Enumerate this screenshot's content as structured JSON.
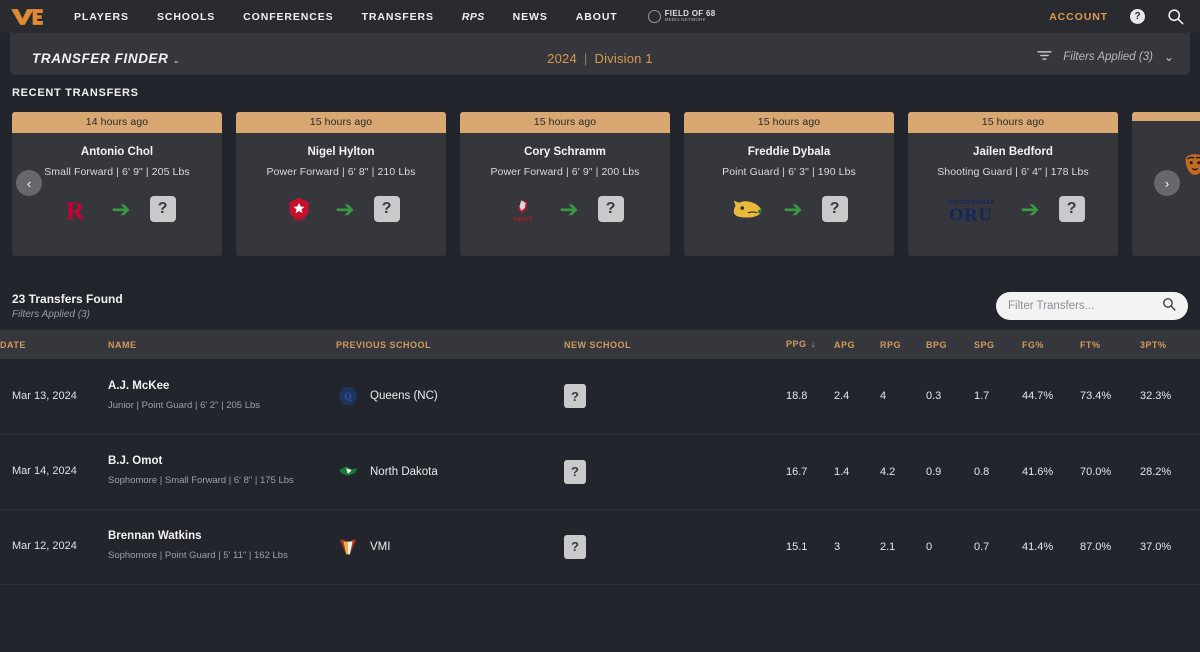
{
  "nav": {
    "logo_name": "verbal-commits-logo",
    "links": [
      {
        "label": "PLAYERS",
        "active": false
      },
      {
        "label": "SCHOOLS",
        "active": false
      },
      {
        "label": "CONFERENCES",
        "active": false
      },
      {
        "label": "TRANSFERS",
        "active": false
      },
      {
        "label": "RPS",
        "active": true
      },
      {
        "label": "NEWS",
        "active": false
      },
      {
        "label": "ABOUT",
        "active": false
      }
    ],
    "partner": {
      "line1": "FIELD OF 68",
      "line2": "MEDIA NETWORK"
    },
    "account_label": "ACCOUNT",
    "help_glyph": "?",
    "accent": "#d89a4e"
  },
  "finder": {
    "title": "TRANSFER FINDER",
    "caret": "⌄",
    "season": "2024",
    "separator": "|",
    "division": "Division 1",
    "filters_label": "Filters Applied (3)",
    "chevron": "⌄"
  },
  "recent": {
    "heading": "RECENT TRANSFERS",
    "prev_glyph": "‹",
    "next_glyph": "›",
    "arrow_glyph": "➔",
    "unknown_glyph": "?",
    "cards": [
      {
        "time": "14 hours ago",
        "name": "Antonio Chol",
        "meta": "Small Forward  |  6' 9\"  |  205 Lbs",
        "from_logo": "rutgers-logo"
      },
      {
        "time": "15 hours ago",
        "name": "Nigel Hylton",
        "meta": "Power Forward  |  6' 8\"  |  210 Lbs",
        "from_logo": "sfu-logo"
      },
      {
        "time": "15 hours ago",
        "name": "Cory Schramm",
        "meta": "Power Forward  |  6' 9\"  |  200 Lbs",
        "from_logo": "saints-logo"
      },
      {
        "time": "15 hours ago",
        "name": "Freddie Dybala",
        "meta": "Point Guard  |  6' 3\"  |  190 Lbs",
        "from_logo": "golden-cat-logo"
      },
      {
        "time": "15 hours ago",
        "name": "Jailen Bedford",
        "meta": "Shooting Guard  |  6' 4\"  |  178 Lbs",
        "from_logo": "oru-logo"
      },
      {
        "time": "",
        "name": "",
        "meta": "",
        "from_logo": "tiger-logo"
      }
    ]
  },
  "results": {
    "count_label": "23 Transfers Found",
    "filters_label": "Filters Applied (3)",
    "filter_placeholder": "Filter Transfers...",
    "filter_value": ""
  },
  "table": {
    "columns": [
      {
        "key": "date",
        "label": "DATE",
        "sorted": false
      },
      {
        "key": "name",
        "label": "NAME",
        "sorted": false
      },
      {
        "key": "prev",
        "label": "PREVIOUS SCHOOL",
        "sorted": false
      },
      {
        "key": "new",
        "label": "NEW SCHOOL",
        "sorted": false
      },
      {
        "key": "ppg",
        "label": "PPG",
        "sorted": true,
        "sort_dir": "↓"
      },
      {
        "key": "apg",
        "label": "APG",
        "sorted": false
      },
      {
        "key": "rpg",
        "label": "RPG",
        "sorted": false
      },
      {
        "key": "bpg",
        "label": "BPG",
        "sorted": false
      },
      {
        "key": "spg",
        "label": "SPG",
        "sorted": false
      },
      {
        "key": "fg",
        "label": "FG%",
        "sorted": false
      },
      {
        "key": "ft",
        "label": "FT%",
        "sorted": false
      },
      {
        "key": "3pt",
        "label": "3PT%",
        "sorted": false
      }
    ],
    "unknown_glyph": "?",
    "rows": [
      {
        "date": "Mar 13, 2024",
        "name": "A.J. McKee",
        "detail": "Junior  |  Point Guard  |  6' 2\"  |  205 Lbs",
        "prev_school": "Queens (NC)",
        "prev_logo": "queens-nc-logo",
        "new_school": "?",
        "ppg": "18.8",
        "apg": "2.4",
        "rpg": "4",
        "bpg": "0.3",
        "spg": "1.7",
        "fg": "44.7%",
        "ft": "73.4%",
        "three": "32.3%"
      },
      {
        "date": "Mar 14, 2024",
        "name": "B.J. Omot",
        "detail": "Sophomore  |  Small Forward  |  6' 8\"  |  175 Lbs",
        "prev_school": "North Dakota",
        "prev_logo": "north-dakota-logo",
        "new_school": "?",
        "ppg": "16.7",
        "apg": "1.4",
        "rpg": "4.2",
        "bpg": "0.9",
        "spg": "0.8",
        "fg": "41.6%",
        "ft": "70.0%",
        "three": "28.2%"
      },
      {
        "date": "Mar 12, 2024",
        "name": "Brennan Watkins",
        "detail": "Sophomore  |  Point Guard  |  5' 11\"  |  162 Lbs",
        "prev_school": "VMI",
        "prev_logo": "vmi-logo",
        "new_school": "?",
        "ppg": "15.1",
        "apg": "3",
        "rpg": "2.1",
        "bpg": "0",
        "spg": "0.7",
        "fg": "41.4%",
        "ft": "87.0%",
        "three": "37.0%"
      }
    ]
  }
}
